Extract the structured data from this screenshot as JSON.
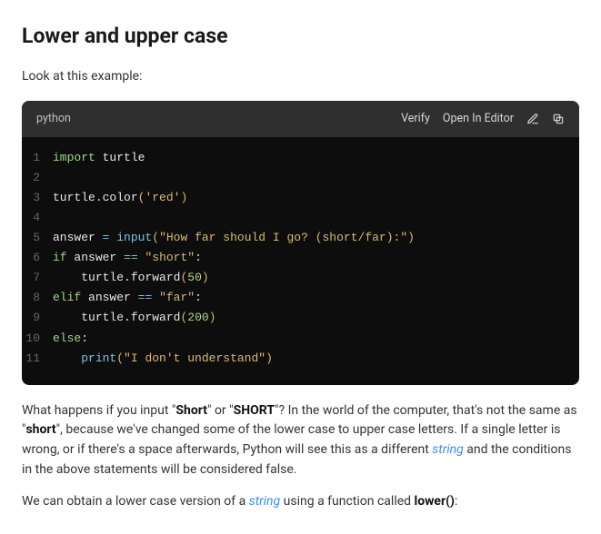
{
  "heading": "Lower and upper case",
  "intro": "Look at this example:",
  "code_header": {
    "lang": "python",
    "verify": "Verify",
    "open": "Open In Editor"
  },
  "code": {
    "lines": [
      {
        "n": "1",
        "tokens": [
          [
            "kw",
            "import"
          ],
          [
            "sp",
            " "
          ],
          [
            "mod",
            "turtle"
          ]
        ]
      },
      {
        "n": "2",
        "tokens": []
      },
      {
        "n": "3",
        "tokens": [
          [
            "mod",
            "turtle"
          ],
          [
            "dot",
            "."
          ],
          [
            "meth",
            "color"
          ],
          [
            "paren",
            "("
          ],
          [
            "str",
            "'red'"
          ],
          [
            "paren",
            ")"
          ]
        ]
      },
      {
        "n": "4",
        "tokens": []
      },
      {
        "n": "5",
        "tokens": [
          [
            "var",
            "answer"
          ],
          [
            "sp",
            " "
          ],
          [
            "eq",
            "="
          ],
          [
            "sp",
            " "
          ],
          [
            "fn",
            "input"
          ],
          [
            "paren",
            "("
          ],
          [
            "str",
            "\"How far should I go? (short/far):\""
          ],
          [
            "paren",
            ")"
          ]
        ]
      },
      {
        "n": "6",
        "tokens": [
          [
            "kw",
            "if"
          ],
          [
            "sp",
            " "
          ],
          [
            "var",
            "answer"
          ],
          [
            "sp",
            " "
          ],
          [
            "eq",
            "=="
          ],
          [
            "sp",
            " "
          ],
          [
            "str",
            "\"short\""
          ],
          [
            "dot",
            ":"
          ]
        ]
      },
      {
        "n": "7",
        "tokens": [
          [
            "sp",
            "    "
          ],
          [
            "mod",
            "turtle"
          ],
          [
            "dot",
            "."
          ],
          [
            "meth",
            "forward"
          ],
          [
            "paren",
            "("
          ],
          [
            "num",
            "50"
          ],
          [
            "paren",
            ")"
          ]
        ]
      },
      {
        "n": "8",
        "tokens": [
          [
            "kw",
            "elif"
          ],
          [
            "sp",
            " "
          ],
          [
            "var",
            "answer"
          ],
          [
            "sp",
            " "
          ],
          [
            "eq",
            "=="
          ],
          [
            "sp",
            " "
          ],
          [
            "str",
            "\"far\""
          ],
          [
            "dot",
            ":"
          ]
        ]
      },
      {
        "n": "9",
        "tokens": [
          [
            "sp",
            "    "
          ],
          [
            "mod",
            "turtle"
          ],
          [
            "dot",
            "."
          ],
          [
            "meth",
            "forward"
          ],
          [
            "paren",
            "("
          ],
          [
            "num",
            "200"
          ],
          [
            "paren",
            ")"
          ]
        ]
      },
      {
        "n": "10",
        "tokens": [
          [
            "kw",
            "else"
          ],
          [
            "dot",
            ":"
          ]
        ]
      },
      {
        "n": "11",
        "tokens": [
          [
            "sp",
            "    "
          ],
          [
            "fn",
            "print"
          ],
          [
            "paren",
            "("
          ],
          [
            "str",
            "\"I don't understand\""
          ],
          [
            "paren",
            ")"
          ]
        ]
      }
    ]
  },
  "para1": {
    "seg0": "What happens if you input \"",
    "b1": "Short",
    "seg1": "\" or \"",
    "b2": "SHORT",
    "seg2": "\"? In the world of the computer, that's not the same as \"",
    "b3": "short",
    "seg3": "\", because we've changed some of the lower case to upper case letters. If a single letter is wrong, or if there's a space afterwards, Python will see this as a different ",
    "link": "string",
    "seg4": " and the conditions in the above statements will be considered false."
  },
  "para2": {
    "seg0": "We can obtain a lower case version of a ",
    "link": "string",
    "seg1": " using a function called ",
    "b1": "lower()",
    "seg2": ":"
  }
}
